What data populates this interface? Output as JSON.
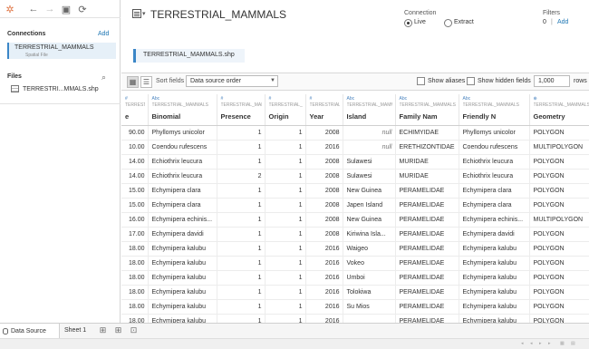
{
  "toolbar": {
    "icons": [
      "tableau-logo-icon",
      "back-icon",
      "forward-icon",
      "save-icon",
      "refresh-icon"
    ]
  },
  "sidebar": {
    "connections_title": "Connections",
    "connections_add": "Add",
    "connection": {
      "name": "TERRESTRIAL_MAMMALS",
      "type": "Spatial File"
    },
    "files_title": "Files",
    "file": "TERRESTRI...MMALS.shp"
  },
  "header": {
    "title": "TERRESTRIAL_MAMMALS",
    "connection_label": "Connection",
    "live_label": "Live",
    "extract_label": "Extract",
    "selected_mode": "Live",
    "filters_label": "Filters",
    "filters_count": "0",
    "filters_sep": "|",
    "filters_add": "Add"
  },
  "canvas": {
    "table": "TERRESTRIAL_MAMMALS.shp"
  },
  "grid_toolbar": {
    "sort_label": "Sort fields",
    "sort_value": "Data source order",
    "show_aliases": "Show aliases",
    "show_hidden": "Show hidden fields",
    "rows_value": "1,000",
    "rows_label": "rows"
  },
  "columns": [
    {
      "icon": "#",
      "source": "TERRESTRIAL_MAMMALS",
      "name": "e"
    },
    {
      "icon": "Abc",
      "source": "TERRESTRIAL_MAMMALS",
      "name": "Binomial"
    },
    {
      "icon": "#",
      "source": "TERRESTRIAL_MAMMALS",
      "name": "Presence"
    },
    {
      "icon": "#",
      "source": "TERRESTRIAL_MAMMALS",
      "name": "Origin"
    },
    {
      "icon": "#",
      "source": "TERRESTRIAL_MAMMALS",
      "name": "Year"
    },
    {
      "icon": "Abc",
      "source": "TERRESTRIAL_MAMMALS",
      "name": "Island"
    },
    {
      "icon": "Abc",
      "source": "TERRESTRIAL_MAMMALS",
      "name": "Family Nam"
    },
    {
      "icon": "Abc",
      "source": "TERRESTRIAL_MAMMALS",
      "name": "Friendly N"
    },
    {
      "icon": "globe",
      "source": "TERRESTRIAL_MAMMALS",
      "name": "Geometry"
    }
  ],
  "rows": [
    [
      "90.00",
      "Phyllomys unicolor",
      "1",
      "1",
      "2008",
      "null",
      "ECHIMYIDAE",
      "Phyllomys unicolor",
      "POLYGON"
    ],
    [
      "10.00",
      "Coendou rufescens",
      "1",
      "1",
      "2016",
      "null",
      "ERETHIZONTIDAE",
      "Coendou rufescens",
      "MULTIPOLYGON"
    ],
    [
      "14.00",
      "Echiothrix leucura",
      "1",
      "1",
      "2008",
      "Sulawesi",
      "MURIDAE",
      "Echiothrix leucura",
      "POLYGON"
    ],
    [
      "14.00",
      "Echiothrix leucura",
      "2",
      "1",
      "2008",
      "Sulawesi",
      "MURIDAE",
      "Echiothrix leucura",
      "POLYGON"
    ],
    [
      "15.00",
      "Echymipera clara",
      "1",
      "1",
      "2008",
      "New Guinea",
      "PERAMELIDAE",
      "Echymipera clara",
      "POLYGON"
    ],
    [
      "15.00",
      "Echymipera clara",
      "1",
      "1",
      "2008",
      "Japen Island",
      "PERAMELIDAE",
      "Echymipera clara",
      "POLYGON"
    ],
    [
      "16.00",
      "Echymipera echinis...",
      "1",
      "1",
      "2008",
      "New Guinea",
      "PERAMELIDAE",
      "Echymipera echinis...",
      "MULTIPOLYGON"
    ],
    [
      "17.00",
      "Echymipera davidi",
      "1",
      "1",
      "2008",
      "Kiriwina Isla...",
      "PERAMELIDAE",
      "Echymipera davidi",
      "POLYGON"
    ],
    [
      "18.00",
      "Echymipera kalubu",
      "1",
      "1",
      "2016",
      "Waigeo",
      "PERAMELIDAE",
      "Echymipera kalubu",
      "POLYGON"
    ],
    [
      "18.00",
      "Echymipera kalubu",
      "1",
      "1",
      "2016",
      "Vokeo",
      "PERAMELIDAE",
      "Echymipera kalubu",
      "POLYGON"
    ],
    [
      "18.00",
      "Echymipera kalubu",
      "1",
      "1",
      "2016",
      "Umboi",
      "PERAMELIDAE",
      "Echymipera kalubu",
      "POLYGON"
    ],
    [
      "18.00",
      "Echymipera kalubu",
      "1",
      "1",
      "2016",
      "Tolokiwa",
      "PERAMELIDAE",
      "Echymipera kalubu",
      "POLYGON"
    ],
    [
      "18.00",
      "Echymipera kalubu",
      "1",
      "1",
      "2016",
      "Su Mios",
      "PERAMELIDAE",
      "Echymipera kalubu",
      "POLYGON"
    ],
    [
      "18.00",
      "Echymipera kalubu",
      "1",
      "1",
      "2016",
      "",
      "PERAMELIDAE",
      "Echymipera kalubu",
      "POLYGON"
    ]
  ],
  "bottom": {
    "tab_datasource": "Data Source",
    "tab_sheet": "Sheet 1"
  },
  "colors": {
    "accent": "#3b86c7",
    "link": "#1f77b4",
    "selected_bg": "#e6f0f8"
  }
}
